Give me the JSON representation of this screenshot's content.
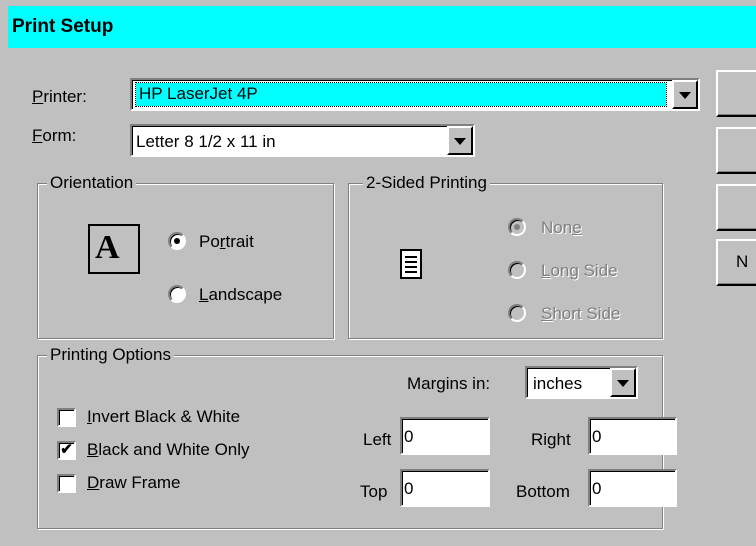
{
  "dialog": {
    "title": "Print Setup",
    "printer": {
      "label_underlined": "P",
      "label_rest": "rinter:",
      "value": "HP LaserJet 4P"
    },
    "form": {
      "label_underlined": "F",
      "label_rest": "orm:",
      "value": "Letter 8 1/2 x 11 in"
    },
    "orientation": {
      "title": "Orientation",
      "icon_glyph": "A",
      "portrait": {
        "pre": "Po",
        "underlined": "r",
        "post": "trait",
        "checked": true
      },
      "landscape": {
        "underlined": "L",
        "post": "andscape",
        "checked": false
      }
    },
    "two_sided": {
      "title": "2-Sided Printing",
      "none": {
        "pre": "Non",
        "underlined": "e",
        "checked": true
      },
      "long_side": {
        "underlined": "L",
        "post": "ong Side",
        "checked": false
      },
      "short_side": {
        "underlined": "S",
        "post": "hort Side",
        "checked": false
      }
    },
    "printing_options": {
      "title": "Printing Options",
      "margins_label": "Margins in:",
      "margins_unit": "inches",
      "invert": {
        "underlined": "I",
        "post": "nvert Black & White",
        "checked": false
      },
      "bw_only": {
        "underlined": "B",
        "post": "lack and White Only",
        "checked": true,
        "mark": "✔"
      },
      "draw_frame": {
        "underlined": "D",
        "post": "raw Frame",
        "checked": false
      },
      "left": {
        "label": "Left",
        "value": "0"
      },
      "right": {
        "label": "Right",
        "value": "0"
      },
      "top": {
        "label": "Top",
        "value": "0"
      },
      "bottom": {
        "label": "Bottom",
        "value": "0"
      }
    },
    "side_buttons": {
      "fourth_partial": "N"
    }
  }
}
